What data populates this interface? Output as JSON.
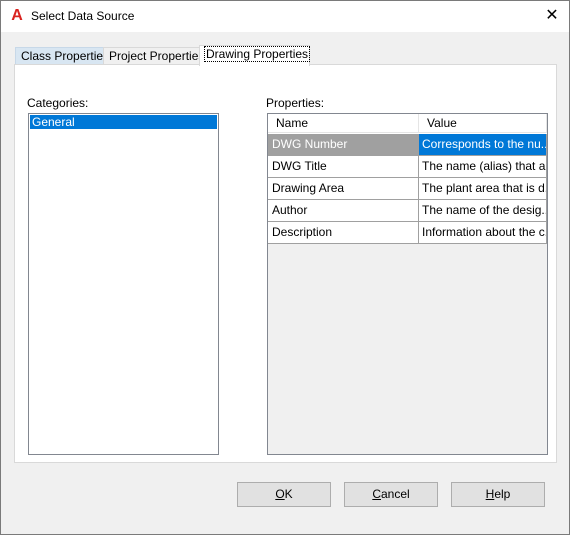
{
  "window": {
    "title": "Select Data Source",
    "icon": "autocad-a-icon",
    "close_glyph": "✕"
  },
  "tabs": [
    {
      "label": "Class Properties",
      "state": "hover"
    },
    {
      "label": "Project Properties",
      "state": "normal"
    },
    {
      "label": "Drawing Properties",
      "state": "active"
    }
  ],
  "categories": {
    "label": "Categories:",
    "items": [
      {
        "label": "General",
        "selected": true
      }
    ]
  },
  "properties": {
    "label": "Properties:",
    "columns": [
      "Name",
      "Value"
    ],
    "rows": [
      {
        "name": "DWG Number",
        "value": "Corresponds to the nu...",
        "selected": true
      },
      {
        "name": "DWG Title",
        "value": "The name (alias) that a..."
      },
      {
        "name": "Drawing Area",
        "value": "The plant area that is d..."
      },
      {
        "name": "Author",
        "value": "The name of the desig..."
      },
      {
        "name": "Description",
        "value": "Information about the c..."
      }
    ]
  },
  "buttons": {
    "ok": {
      "mnemonic": "O",
      "rest": "K"
    },
    "cancel": {
      "mnemonic": "C",
      "rest": "ancel"
    },
    "help": {
      "mnemonic": "H",
      "rest": "elp"
    }
  },
  "colors": {
    "selection": "#0078d7",
    "inactive_selection": "#a0a0a0",
    "app_icon_red": "#d9231f"
  }
}
